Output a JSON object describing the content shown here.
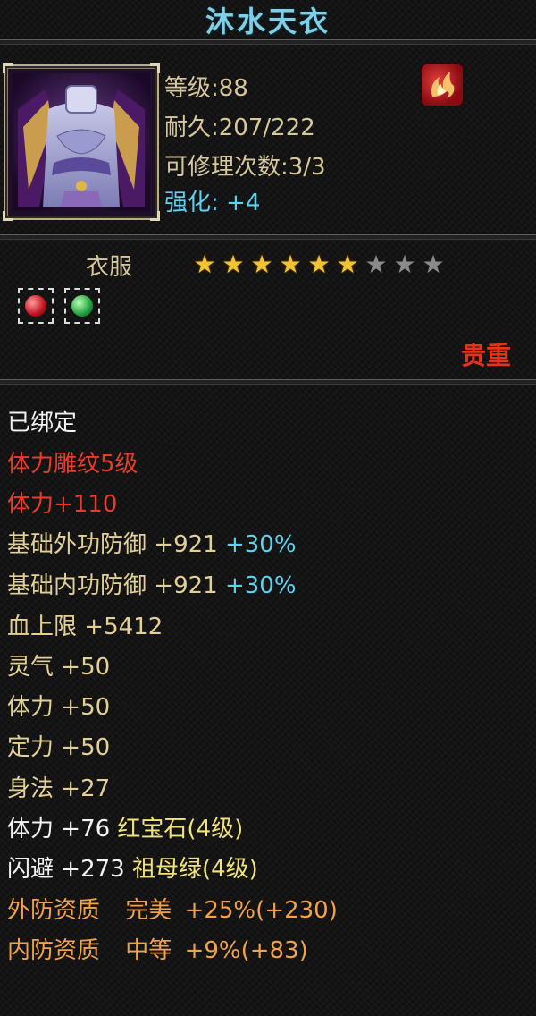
{
  "item": {
    "name": "沐水天衣",
    "level": "等级:88",
    "durability": "耐久:207/222",
    "repair": "可修理次数:3/3",
    "enhance_label": "强化:",
    "enhance_value": "+4",
    "category": "衣服",
    "stars_total": 9,
    "stars_filled": 6,
    "rarity": "贵重",
    "gem_slots": [
      "red-gem",
      "green-gem"
    ]
  },
  "attributes": {
    "bound": "已绑定",
    "engrave": "体力雕纹5级",
    "engrave_bonus": "体力+110",
    "ext_def_label": "基础外功防御",
    "ext_def_value": "+921",
    "ext_def_pct": "+30%",
    "int_def_label": "基础内功防御",
    "int_def_value": "+921",
    "int_def_pct": "+30%",
    "hp_label": "血上限",
    "hp_value": "+5412",
    "spirit_label": "灵气",
    "spirit_value": "+50",
    "vit_label": "体力",
    "vit_value": "+50",
    "focus_label": "定力",
    "focus_value": "+50",
    "agility_label": "身法",
    "agility_value": "+27",
    "vit_gem_label": "体力",
    "vit_gem_value": "+76",
    "vit_gem_name": "红宝石(4级)",
    "dodge_label": "闪避",
    "dodge_value": "+273",
    "dodge_gem_name": "祖母绿(4级)",
    "ext_quality_label": "外防资质",
    "ext_quality_grade": "完美",
    "ext_quality_value": "+25%(+230)",
    "int_quality_label": "内防资质",
    "int_quality_grade": "中等",
    "int_quality_value": "+9%(+83)"
  },
  "colors": {
    "title": "#7fd0e6",
    "bound": "#f2f2f2",
    "engrave": "#ea3b2a",
    "base": "#e3d095",
    "percent": "#5cd2ee",
    "gem": "#f2e37a",
    "quality": "#f1a24a",
    "rarity": "#e8321a",
    "star_filled": "#f0c234",
    "star_empty": "#8a8a8a"
  }
}
